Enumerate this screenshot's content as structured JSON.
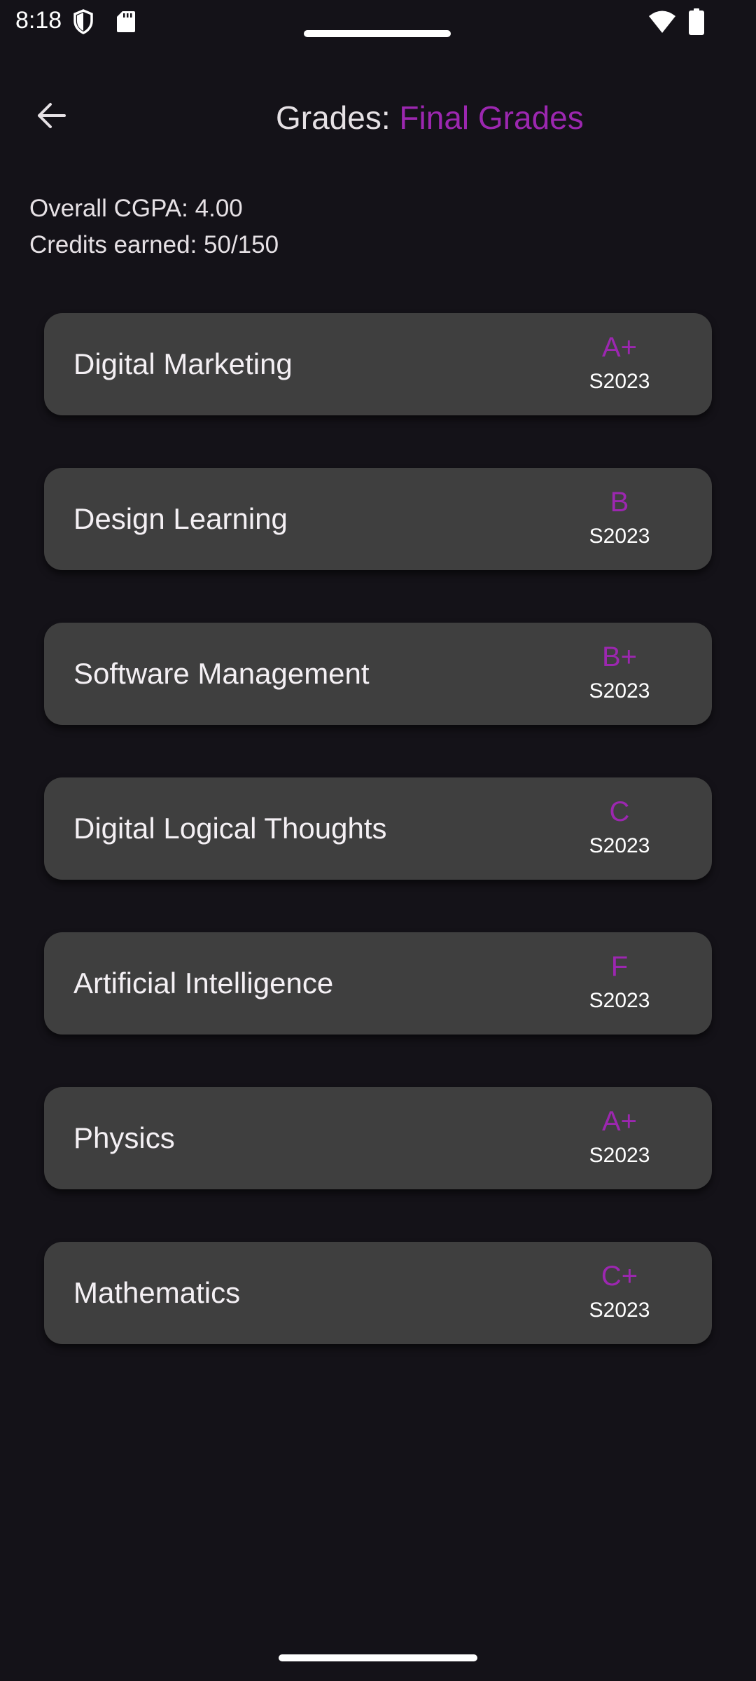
{
  "status_bar": {
    "time": "8:18",
    "icons": [
      "shield-icon",
      "sd-card-icon",
      "wifi-icon",
      "battery-icon"
    ]
  },
  "header": {
    "back_icon": "arrow-left-icon",
    "title_prefix": "Grades: ",
    "title_accent": "Final Grades"
  },
  "summary": {
    "cgpa": "Overall CGPA: 4.00",
    "credits": "Credits earned: 50/150"
  },
  "courses": [
    {
      "name": "Digital Marketing",
      "grade": "A+",
      "term": "S2023"
    },
    {
      "name": "Design Learning",
      "grade": "B",
      "term": "S2023"
    },
    {
      "name": "Software Management",
      "grade": "B+",
      "term": "S2023"
    },
    {
      "name": "Digital Logical Thoughts",
      "grade": "C",
      "term": "S2023"
    },
    {
      "name": "Artificial Intelligence",
      "grade": "F",
      "term": "S2023"
    },
    {
      "name": "Physics",
      "grade": "A+",
      "term": "S2023"
    },
    {
      "name": "Mathematics",
      "grade": "C+",
      "term": "S2023"
    }
  ],
  "colors": {
    "background": "#141218",
    "card": "#3F3F3F",
    "accent": "#9C27B0",
    "text": "#E6E1E5"
  }
}
